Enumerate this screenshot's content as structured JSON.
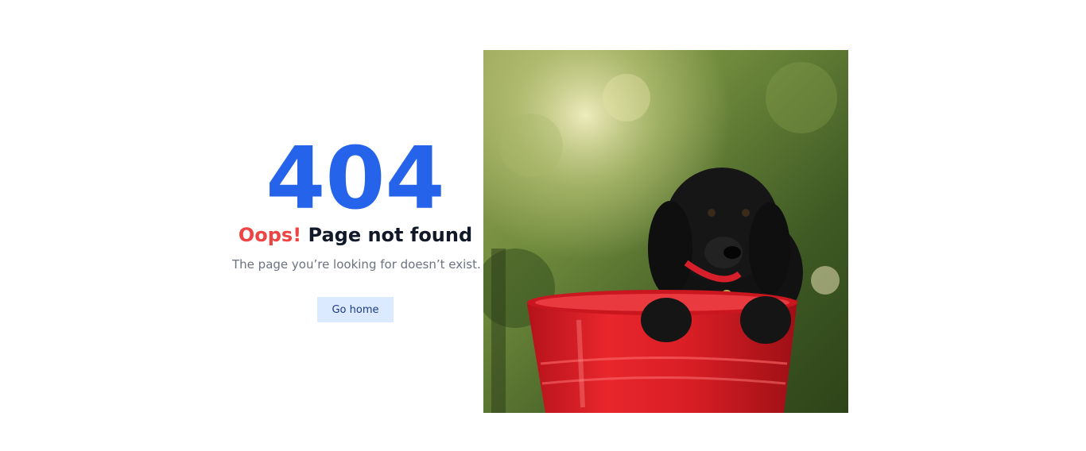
{
  "error": {
    "code": "404",
    "headline_accent": "Oops!",
    "headline_rest": "Page not found",
    "message": "The page you’re looking for doesn’t exist."
  },
  "actions": {
    "home_label": "Go home"
  },
  "colors": {
    "code": "#2563eb",
    "accent": "#ef4444",
    "heading": "#111827",
    "muted": "#6b7280",
    "button_bg": "#dbeafe",
    "button_text": "#1e3a8a"
  },
  "illustration": {
    "subject": "black puppy in red bucket"
  }
}
